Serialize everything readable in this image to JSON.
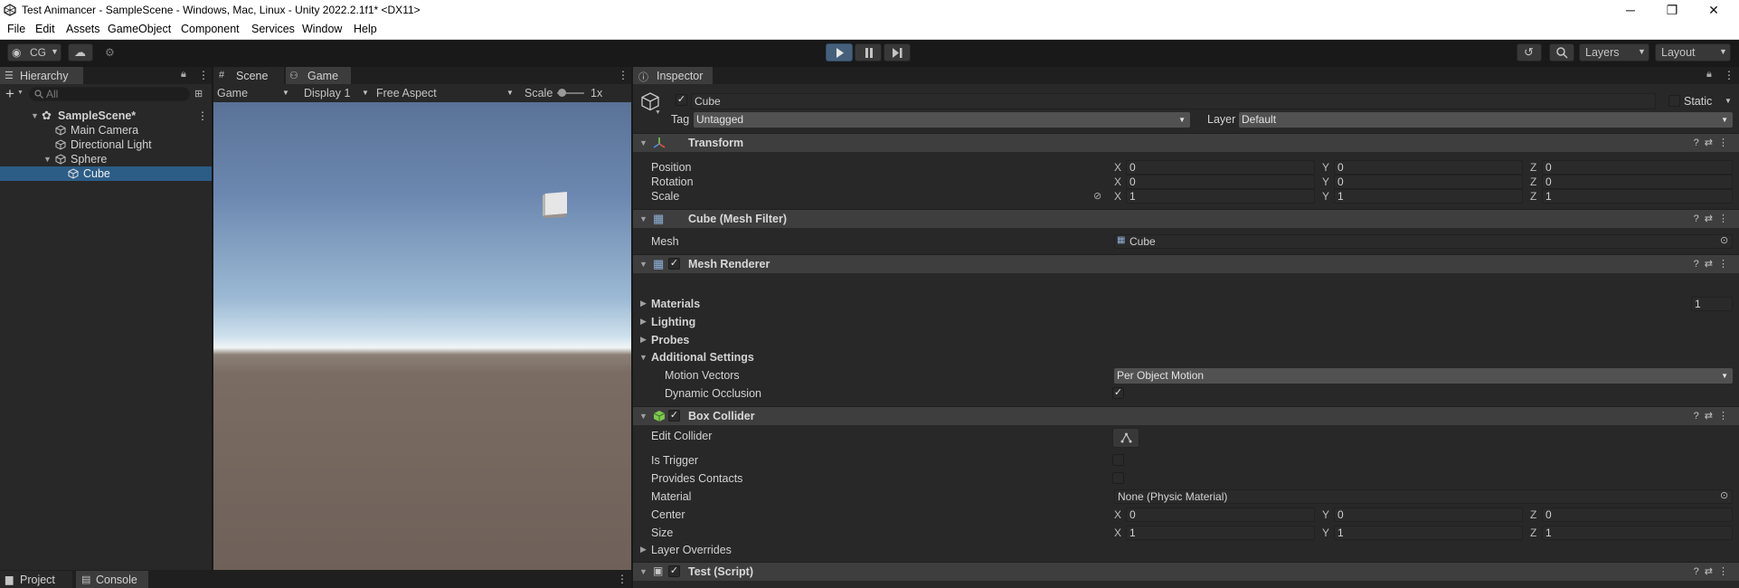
{
  "window": {
    "title": "Test Animancer - SampleScene - Windows, Mac, Linux - Unity 2022.2.1f1* <DX11>",
    "controls": [
      "─",
      "❐",
      "✕"
    ]
  },
  "menu": [
    "File",
    "Edit",
    "Assets",
    "GameObject",
    "Component",
    "Services",
    "Window",
    "Help"
  ],
  "toolbar": {
    "account": "CG",
    "layers": "Layers",
    "layout": "Layout"
  },
  "hierarchy": {
    "tab": "Hierarchy",
    "search_placeholder": "All",
    "items": [
      {
        "label": "SampleScene*"
      },
      {
        "label": "Main Camera"
      },
      {
        "label": "Directional Light"
      },
      {
        "label": "Sphere"
      },
      {
        "label": "Cube"
      }
    ]
  },
  "game": {
    "tabs": [
      "Scene",
      "Game"
    ],
    "mode": "Game",
    "display": "Display 1",
    "aspect": "Free Aspect",
    "scale_label": "Scale",
    "scale_value": "1x"
  },
  "bottom_tabs": [
    "Project",
    "Console"
  ],
  "inspector": {
    "tab": "Inspector",
    "object_name": "Cube",
    "static_label": "Static",
    "tag_label": "Tag",
    "tag_value": "Untagged",
    "layer_label": "Layer",
    "layer_value": "Default",
    "transform": {
      "title": "Transform",
      "position_label": "Position",
      "rotation_label": "Rotation",
      "scale_label": "Scale",
      "position": [
        "0",
        "0",
        "0"
      ],
      "rotation": [
        "0",
        "0",
        "0"
      ],
      "scale": [
        "1",
        "1",
        "1"
      ]
    },
    "mesh_filter": {
      "title": "Cube (Mesh Filter)",
      "mesh_label": "Mesh",
      "mesh_value": "Cube"
    },
    "mesh_renderer": {
      "title": "Mesh Renderer",
      "materials_label": "Materials",
      "materials_count": "1",
      "lighting_label": "Lighting",
      "probes_label": "Probes",
      "additional_label": "Additional Settings",
      "motion_vectors_label": "Motion Vectors",
      "motion_vectors_value": "Per Object Motion",
      "dynamic_occlusion_label": "Dynamic Occlusion"
    },
    "box_collider": {
      "title": "Box Collider",
      "edit_collider_label": "Edit Collider",
      "is_trigger_label": "Is Trigger",
      "provides_contacts_label": "Provides Contacts",
      "material_label": "Material",
      "material_value": "None (Physic Material)",
      "center_label": "Center",
      "size_label": "Size",
      "center": [
        "0",
        "0",
        "0"
      ],
      "size": [
        "1",
        "1",
        "1"
      ],
      "layer_overrides_label": "Layer Overrides"
    },
    "script": {
      "title": "Test (Script)"
    },
    "axes": [
      "X",
      "Y",
      "Z"
    ]
  }
}
